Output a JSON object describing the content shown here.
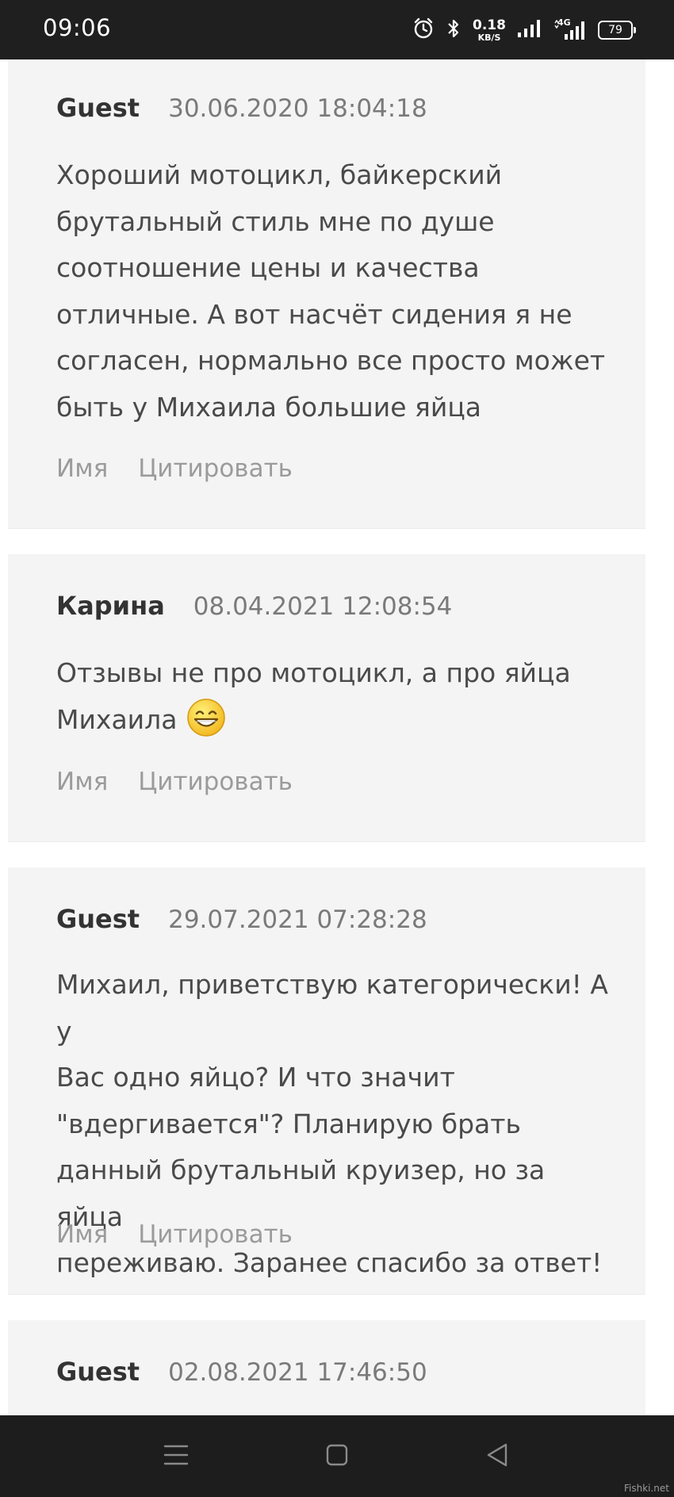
{
  "status_bar": {
    "time": "09:06",
    "net_speed_value": "0.18",
    "net_speed_unit": "KB/S",
    "network_type": "4G",
    "battery": "79",
    "icons": [
      "alarm-icon",
      "bluetooth-icon",
      "signal-icon",
      "signal-4g-icon",
      "battery-icon"
    ]
  },
  "comments": [
    {
      "author": "Guest",
      "date": "30.06.2020 18:04:18",
      "lines": [
        "Хороший мотоцикл, байкерский",
        "брутальный стиль мне по душе",
        "соотношение цены и качества",
        "отличные. А вот насчёт сидения я не",
        "согласен, нормально все просто может",
        "быть у Михаила большие яйца"
      ],
      "actions": [
        "Имя",
        "Цитировать"
      ]
    },
    {
      "author": "Карина",
      "date": "08.04.2021 12:08:54",
      "lines": [
        "Отзывы не про мотоцикл, а про яйца",
        "Михаила"
      ],
      "emoji": "grinning-face-icon",
      "actions": [
        "Имя",
        "Цитировать"
      ]
    },
    {
      "author": "Guest",
      "date": "29.07.2021 07:28:28",
      "lines": [
        "Михаил, приветствую категорически! А у",
        "Вас одно яйцо? И что значит",
        "\"вдергивается\"? Планирую брать",
        "данный брутальный круизер, но за яйца",
        "переживаю. Заранее спасибо за ответ!"
      ],
      "actions": [
        "Имя",
        "Цитировать"
      ]
    },
    {
      "author": "Guest",
      "date": "02.08.2021 17:46:50"
    }
  ],
  "nav_bar": {
    "icons": [
      "menu-icon",
      "home-icon",
      "back-icon"
    ]
  },
  "watermark": "Fishki.net",
  "colors": {
    "status_bar_bg": "#1f1f1f",
    "card_bg": "#f4f4f4",
    "author_text": "#333333",
    "date_text": "#7a7a7a",
    "body_text": "#4a4a4a",
    "action_text": "#9b9b9b",
    "nav_bar_bg": "#1d1d1d"
  }
}
